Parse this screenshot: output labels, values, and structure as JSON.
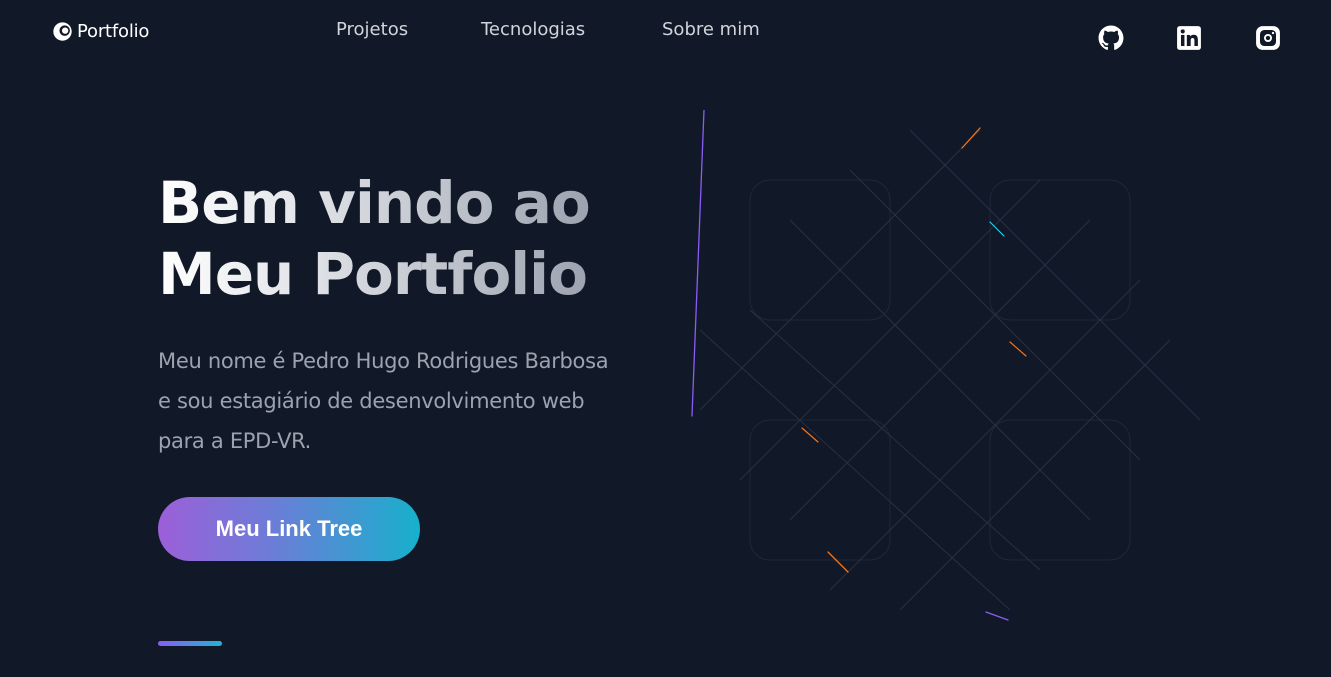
{
  "header": {
    "logo_text": "Portfolio",
    "nav": [
      {
        "label": "Projetos"
      },
      {
        "label": "Tecnologias"
      },
      {
        "label": "Sobre mim"
      }
    ],
    "social_icons": [
      "github-icon",
      "linkedin-icon",
      "instagram-icon"
    ]
  },
  "hero": {
    "title_line1": "Bem vindo ao",
    "title_line2": "Meu Portfolio",
    "description_lines": [
      "Meu nome é Pedro Hugo Rodrigues Barbosa",
      "e sou estagiário de desenvolvimento web",
      "para a EPD-VR."
    ],
    "cta_label": "Meu Link Tree"
  },
  "colors": {
    "background": "#111827",
    "gradient_start": "#9c5fd9",
    "gradient_end": "#18b0cc",
    "text_muted": "#9ca3af"
  }
}
